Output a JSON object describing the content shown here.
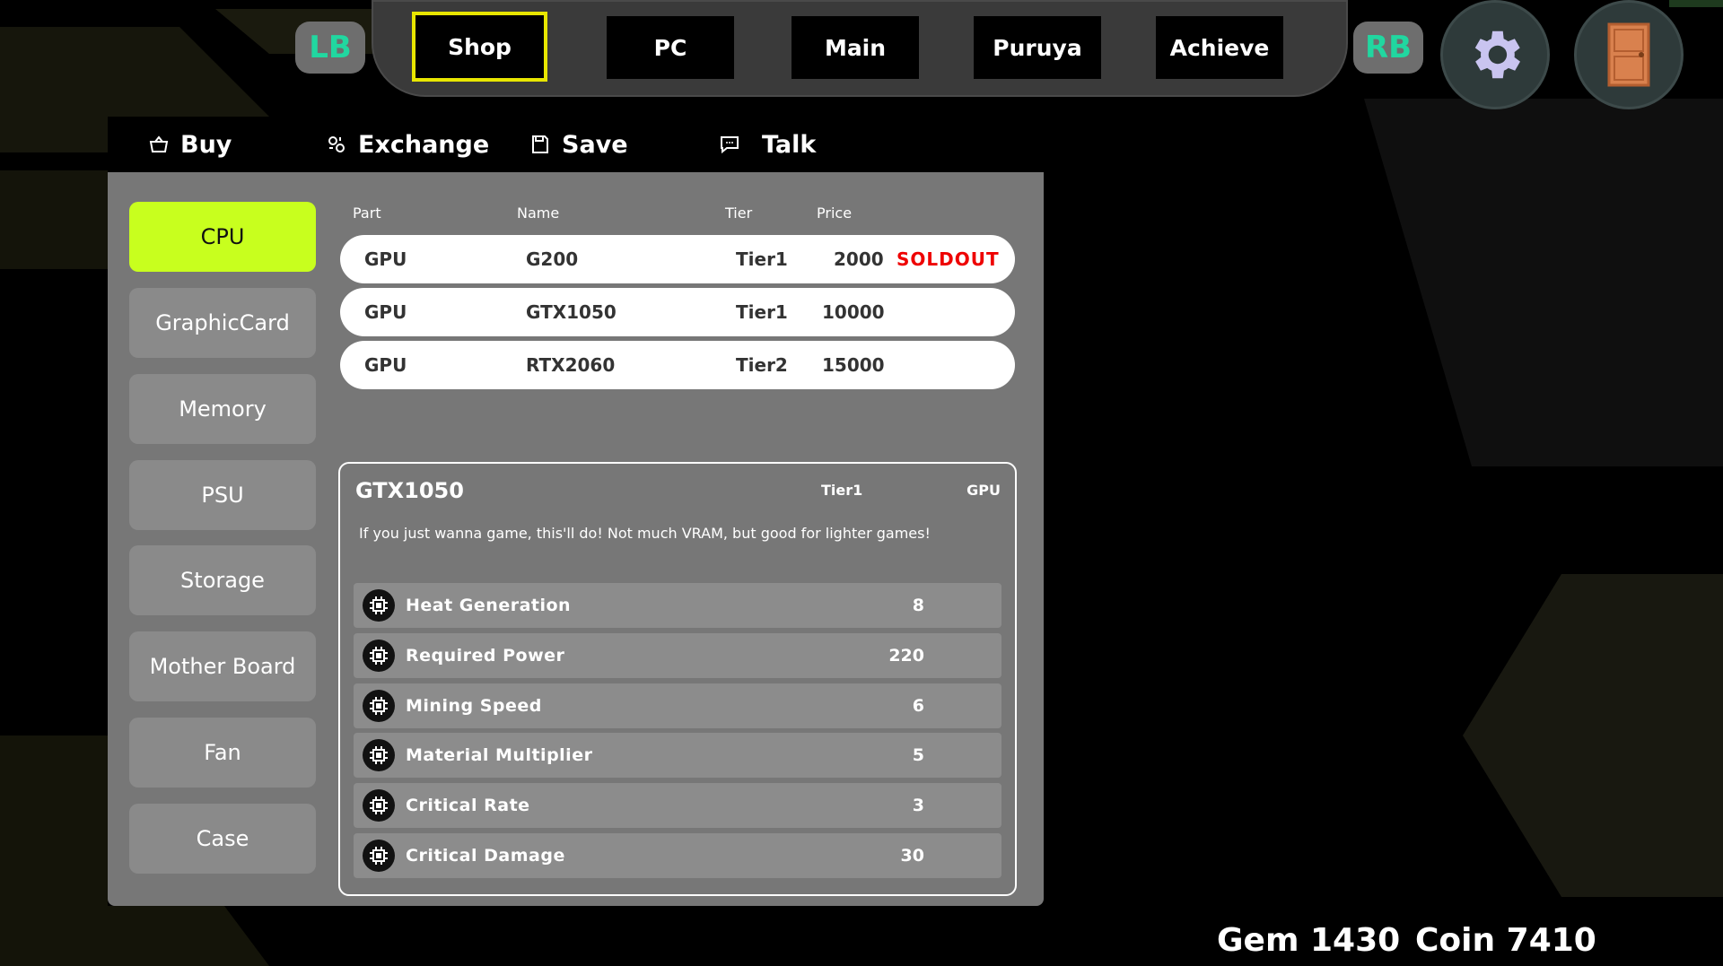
{
  "nav": {
    "left_bumper": "LB",
    "right_bumper": "RB",
    "tabs": [
      {
        "label": "Shop",
        "active": true
      },
      {
        "label": "PC"
      },
      {
        "label": "Main"
      },
      {
        "label": "Puruya"
      },
      {
        "label": "Achieve"
      }
    ],
    "settings_icon": "gear-icon",
    "exit_icon": "door-icon"
  },
  "panel_tabs": [
    {
      "label": "Buy",
      "icon": "basket-icon"
    },
    {
      "label": "Exchange",
      "icon": "exchange-icon"
    },
    {
      "label": "Save",
      "icon": "save-icon"
    },
    {
      "label": "Talk",
      "icon": "chat-icon"
    }
  ],
  "categories": [
    "CPU",
    "GraphicCard",
    "Memory",
    "PSU",
    "Storage",
    "Mother Board",
    "Fan",
    "Case"
  ],
  "active_category": "CPU",
  "table": {
    "headers": [
      "Part",
      "Name",
      "Tier",
      "Price"
    ],
    "rows": [
      {
        "part": "GPU",
        "name": "G200",
        "tier": "Tier1",
        "price": "2000",
        "status": "SOLDOUT"
      },
      {
        "part": "GPU",
        "name": "GTX1050",
        "tier": "Tier1",
        "price": "10000",
        "status": ""
      },
      {
        "part": "GPU",
        "name": "RTX2060",
        "tier": "Tier2",
        "price": "15000",
        "status": ""
      }
    ]
  },
  "detail": {
    "name": "GTX1050",
    "tier": "Tier1",
    "part": "GPU",
    "description": "If you just wanna game, this'll do! Not much VRAM, but good for lighter games!",
    "stats": [
      {
        "label": "Heat Generation",
        "value": "8"
      },
      {
        "label": "Required Power",
        "value": "220"
      },
      {
        "label": "Mining Speed",
        "value": "6"
      },
      {
        "label": "Material Multiplier",
        "value": "5"
      },
      {
        "label": "Critical Rate",
        "value": "3"
      },
      {
        "label": "Critical Damage",
        "value": "30"
      }
    ]
  },
  "currency": {
    "gem": "Gem 1430",
    "coin": "Coin 7410"
  },
  "colors": {
    "accent_active_category": "#c8ff1e",
    "active_tab_border": "#e8e600",
    "bumper_text": "#21d7a0",
    "soldout": "#e00000"
  }
}
